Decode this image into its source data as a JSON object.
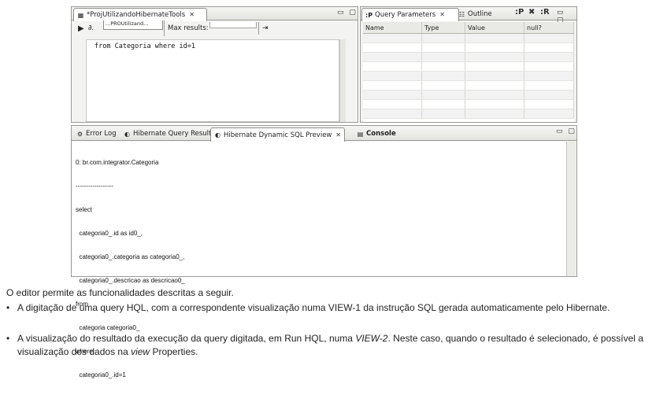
{
  "editor": {
    "tab_label": "*ProjUtilizandoHibernateTools",
    "tab_close": "✕",
    "config_value": "...PROUtilizand...",
    "max_results_label": "Max results:",
    "query_text": "from Categoria where id=1"
  },
  "query_params": {
    "tab_label": "Query Parameters",
    "tab_close": "✕",
    "outline_label": "Outline",
    "columns": [
      "Name",
      "Type",
      "Value",
      "null?"
    ],
    "rows": 9
  },
  "bottom": {
    "tabs": [
      {
        "label": "Error Log"
      },
      {
        "label": "Hibernate Query Result"
      },
      {
        "label": "Hibernate Dynamic SQL Preview",
        "close": "✕"
      },
      {
        "label": "Console"
      }
    ],
    "sql_lines": [
      "0: br.com.integrator.Categoria",
      "------------------",
      "select",
      "  categoria0_.id as id0_,",
      "  categoria0_.categoria as categoria0_,",
      "  categoria0_.descricao as descricao0_",
      "from",
      "  categoria categoria0_",
      "where",
      "  categoria0_.id=1"
    ]
  },
  "text": {
    "intro": "O editor permite as funcionalidades descritas a seguir.",
    "bullet1": "A digitação de uma query HQL, com a correspondente visualização numa VIEW-1 da instrução SQL gerada automaticamente pelo Hibernate.",
    "bullet2_a": "A visualização do resultado da execução da query digitada, em Run HQL, numa ",
    "bullet2_em1": "VIEW-2",
    "bullet2_b": ". Neste caso, quando o resultado é selecionado, é possível a visualização dos dados na ",
    "bullet2_em2": "view",
    "bullet2_c": " Properties."
  }
}
